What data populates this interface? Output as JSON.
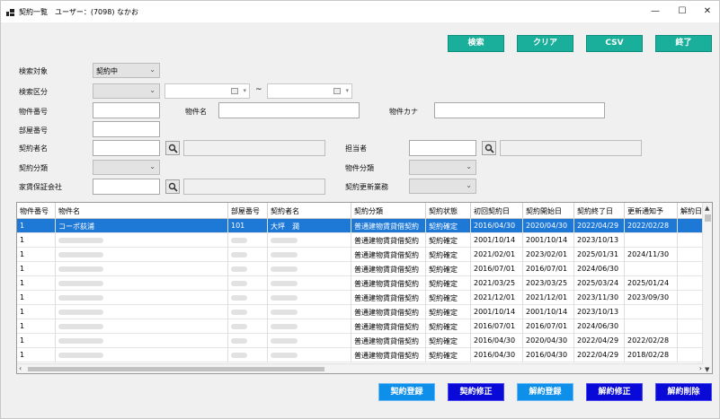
{
  "window": {
    "title": "契約一覧　ユーザー：(7098) なかお",
    "minimize_glyph": "—",
    "maximize_glyph": "☐",
    "close_glyph": "✕"
  },
  "toolbar": {
    "search_label": "検索",
    "clear_label": "クリア",
    "csv_label": "CSV",
    "exit_label": "終了",
    "button_color": "#1aaf9a"
  },
  "form": {
    "search_target_label": "検索対象",
    "search_target_value": "契約中",
    "search_category_label": "検索区分",
    "range_separator": "~",
    "property_no_label": "物件番号",
    "property_name_label": "物件名",
    "property_kana_label": "物件カナ",
    "room_no_label": "部屋番号",
    "contractor_name_label": "契約者名",
    "staff_label": "担当者",
    "contract_type_label": "契約分類",
    "property_type_label": "物件分類",
    "guarantor_label": "家賃保証会社",
    "renewal_label": "契約更新業務"
  },
  "grid": {
    "columns": [
      "物件番号",
      "物件名",
      "部屋番号",
      "契約者名",
      "契約分類",
      "契約状態",
      "初回契約日",
      "契約開始日",
      "契約終了日",
      "更新通知予",
      "解約日"
    ],
    "rows": [
      {
        "no": "1",
        "name": "コーポ荻浦",
        "room": "101",
        "contractor": "大坪　潤",
        "type": "普通建物賃貸借契約",
        "status": "契約確定",
        "first": "2016/04/30",
        "start": "2020/04/30",
        "end": "2022/04/29",
        "notify": "2022/02/28",
        "cancel": ""
      },
      {
        "no": "1",
        "name": "",
        "room": "",
        "contractor": "",
        "type": "普通建物賃貸借契約",
        "status": "契約確定",
        "first": "2001/10/14",
        "start": "2001/10/14",
        "end": "2023/10/13",
        "notify": "",
        "cancel": ""
      },
      {
        "no": "1",
        "name": "",
        "room": "",
        "contractor": "",
        "type": "普通建物賃貸借契約",
        "status": "契約確定",
        "first": "2021/02/01",
        "start": "2023/02/01",
        "end": "2025/01/31",
        "notify": "2024/11/30",
        "cancel": ""
      },
      {
        "no": "1",
        "name": "",
        "room": "",
        "contractor": "",
        "type": "普通建物賃貸借契約",
        "status": "契約確定",
        "first": "2016/07/01",
        "start": "2016/07/01",
        "end": "2024/06/30",
        "notify": "",
        "cancel": ""
      },
      {
        "no": "1",
        "name": "",
        "room": "",
        "contractor": "",
        "type": "普通建物賃貸借契約",
        "status": "契約確定",
        "first": "2021/03/25",
        "start": "2023/03/25",
        "end": "2025/03/24",
        "notify": "2025/01/24",
        "cancel": ""
      },
      {
        "no": "1",
        "name": "",
        "room": "",
        "contractor": "",
        "type": "普通建物賃貸借契約",
        "status": "契約確定",
        "first": "2021/12/01",
        "start": "2021/12/01",
        "end": "2023/11/30",
        "notify": "2023/09/30",
        "cancel": ""
      },
      {
        "no": "1",
        "name": "",
        "room": "",
        "contractor": "",
        "type": "普通建物賃貸借契約",
        "status": "契約確定",
        "first": "2001/10/14",
        "start": "2001/10/14",
        "end": "2023/10/13",
        "notify": "",
        "cancel": ""
      },
      {
        "no": "1",
        "name": "",
        "room": "",
        "contractor": "",
        "type": "普通建物賃貸借契約",
        "status": "契約確定",
        "first": "2016/07/01",
        "start": "2016/07/01",
        "end": "2024/06/30",
        "notify": "",
        "cancel": ""
      },
      {
        "no": "1",
        "name": "",
        "room": "",
        "contractor": "",
        "type": "普通建物賃貸借契約",
        "status": "契約確定",
        "first": "2016/04/30",
        "start": "2020/04/30",
        "end": "2022/04/29",
        "notify": "2022/02/28",
        "cancel": ""
      },
      {
        "no": "1",
        "name": "",
        "room": "",
        "contractor": "",
        "type": "普通建物賃貸借契約",
        "status": "契約確定",
        "first": "2016/04/30",
        "start": "2016/04/30",
        "end": "2022/04/29",
        "notify": "2018/02/28",
        "cancel": ""
      }
    ]
  },
  "bottom": {
    "register_label": "契約登録",
    "modify_label": "契約修正",
    "cancel_register_label": "解約登録",
    "cancel_modify_label": "解約修正",
    "cancel_delete_label": "解約削除"
  }
}
